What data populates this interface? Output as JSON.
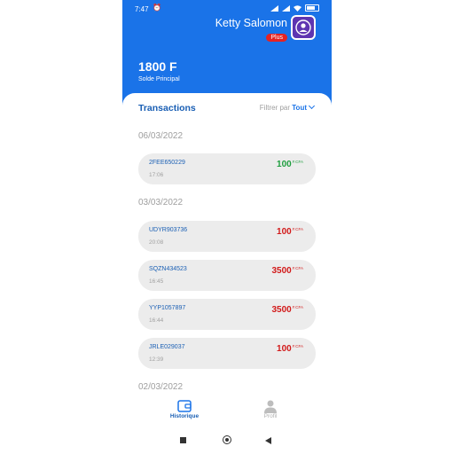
{
  "status_bar": {
    "time": "7:47"
  },
  "header": {
    "user_name": "Ketty Salomon",
    "plan_badge": "Plus",
    "balance": "1800 F",
    "balance_label": "Solde Principal"
  },
  "transactions": {
    "title": "Transactions",
    "filter_label": "Filtrer par",
    "filter_value": "Tout",
    "currency": "F.CFA",
    "groups": [
      {
        "date": "06/03/2022",
        "items": [
          {
            "id": "2FEE650229",
            "time": "17:06",
            "amount": "100",
            "type": "credit"
          }
        ]
      },
      {
        "date": "03/03/2022",
        "items": [
          {
            "id": "UDYR903736",
            "time": "20:08",
            "amount": "100",
            "type": "debit"
          },
          {
            "id": "SQZN434523",
            "time": "16:45",
            "amount": "3500",
            "type": "debit"
          },
          {
            "id": "YYP1057897",
            "time": "16:44",
            "amount": "3500",
            "type": "debit"
          },
          {
            "id": "JRLE029037",
            "time": "12:39",
            "amount": "100",
            "type": "debit"
          }
        ]
      },
      {
        "date": "02/03/2022",
        "items": []
      }
    ]
  },
  "bottom_nav": {
    "items": [
      {
        "label": "Historique",
        "icon": "wallet-icon",
        "active": true
      },
      {
        "label": "Profil",
        "icon": "person-icon",
        "active": false
      }
    ]
  },
  "colors": {
    "primary": "#1a73e8",
    "credit": "#1e9e3e",
    "debit": "#d21a1a",
    "badge": "#e52222",
    "avatar": "#5e35b1"
  }
}
